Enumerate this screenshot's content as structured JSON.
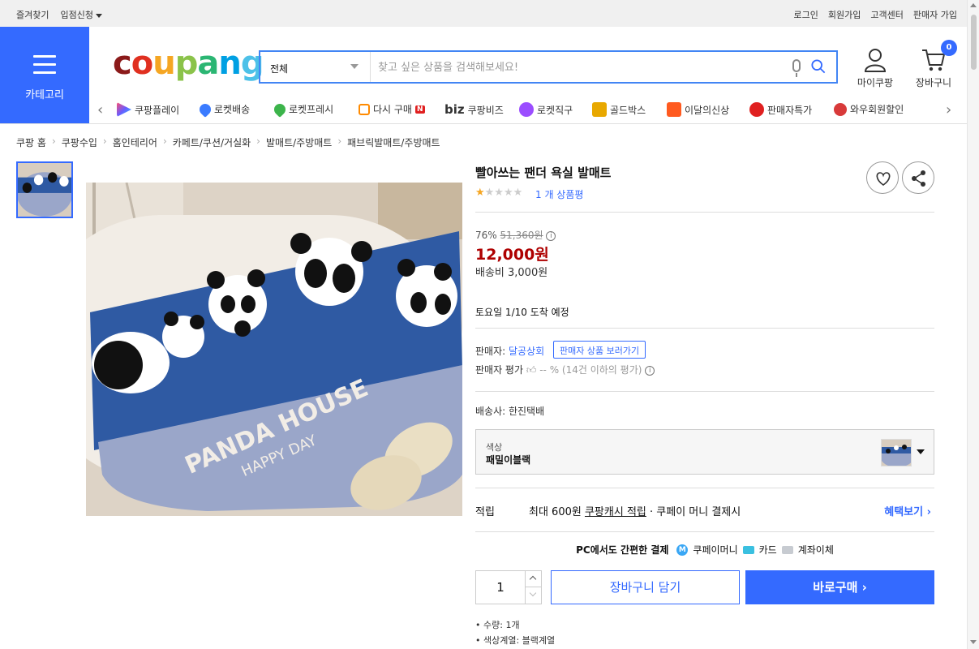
{
  "topbar": {
    "left": [
      "즐겨찾기",
      "입점신청"
    ],
    "right": [
      "로그인",
      "회원가입",
      "고객센터",
      "판매자 가입"
    ]
  },
  "header": {
    "category_label": "카테고리",
    "logo": "coupang",
    "search_scope": "전체",
    "search_placeholder": "찾고 싶은 상품을 검색해보세요!",
    "mypage_label": "마이쿠팡",
    "cart_label": "장바구니",
    "cart_count": "0"
  },
  "shortcuts": [
    {
      "label": "쿠팡플레이",
      "icon": "play-icon",
      "color": "#6a5cff"
    },
    {
      "label": "로켓배송",
      "icon": "rocket-icon",
      "color": "#3a7bff"
    },
    {
      "label": "로켓프레시",
      "icon": "rocket-fresh-icon",
      "color": "#3cb44b"
    },
    {
      "label": "다시 구매",
      "icon": "rebuy-icon",
      "color": "#ff8a00"
    },
    {
      "label": "쿠팡비즈",
      "icon": "biz-icon",
      "color": "#333333"
    },
    {
      "label": "로켓직구",
      "icon": "rocket-global-icon",
      "color": "#9b4dff"
    },
    {
      "label": "골드박스",
      "icon": "goldbox-icon",
      "color": "#e8a800"
    },
    {
      "label": "이달의신상",
      "icon": "new-icon",
      "color": "#ff5a1f"
    },
    {
      "label": "판매자특가",
      "icon": "percent-icon",
      "color": "#e02020"
    },
    {
      "label": "와우회원할인",
      "icon": "wow-icon",
      "color": "#d83a3a"
    }
  ],
  "shortcut_badge": "N",
  "shortcut_biz_prefix": "biz",
  "breadcrumb": [
    "쿠팡 홈",
    "쿠팡수입",
    "홈인테리어",
    "카페트/쿠션/거실화",
    "발매트/주방매트",
    "패브릭발매트/주방매트"
  ],
  "product": {
    "title": "빨아쓰는 팬더 욕실 발매트",
    "stars": "★★★★★",
    "rating": 1,
    "review_link": "1 개 상품평",
    "discount_rate": "76%",
    "original_price": "51,360원",
    "price": "12,000원",
    "shipping_fee": "배송비 3,000원",
    "arrival": "토요일 1/10 도착 예정",
    "seller_label": "판매자:",
    "seller_name": "달공상회",
    "seller_button": "판매자 상품 보러가기",
    "seller_rating_label": "판매자 평가",
    "seller_rating_value": "-- % (14건 이하의 평가)",
    "carrier": "배송사:  한진택배",
    "option_key": "색상",
    "option_value": "패밀이블랙",
    "reward_key": "적립",
    "reward_text_1": "최대 600원",
    "reward_text_2": "쿠팡캐시 적립",
    "reward_text_3": "· 쿠페이 머니 결제시",
    "reward_more": "혜택보기",
    "pay_title": "PC에서도 간편한 결제",
    "pay_methods": [
      "쿠페이머니",
      "카드",
      "계좌이체"
    ],
    "quantity": "1",
    "cart_button": "장바구니 담기",
    "buy_button": "바로구매",
    "attributes": [
      "수량: 1개",
      "색상계열: 블랙계열"
    ]
  },
  "image_text": {
    "line1": "PANDA HOUSE",
    "line2": "HAPPY DAY"
  },
  "colors": {
    "brand": "#346aff",
    "price": "#ae0000",
    "logo_c": "#8b1a1a",
    "logo_o1": "#e03020",
    "logo_u": "#f5a623",
    "logo_p": "#8bc34a",
    "logo_a": "#2bb673",
    "logo_n": "#00a0e3",
    "logo_g": "#4dc1e8"
  }
}
